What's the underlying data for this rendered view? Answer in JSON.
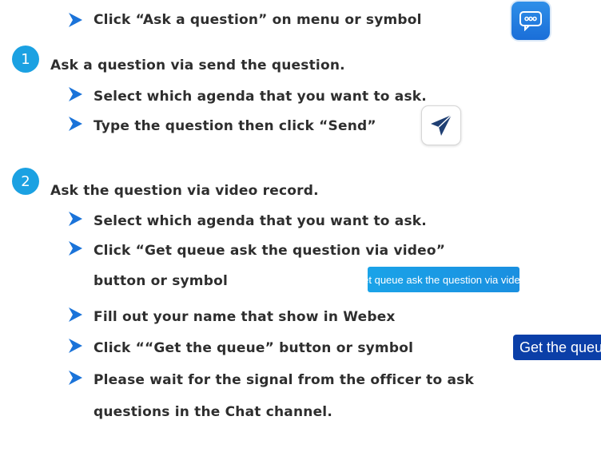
{
  "steps": {
    "intro": "Click “Ask a question” on menu or symbol",
    "s1": {
      "number": "1",
      "title": "Ask a question via send the question.",
      "b1": "Select which agenda that you want to ask.",
      "b2": "Type the question then click “Send”"
    },
    "s2": {
      "number": "2",
      "title": "Ask the question via video record.",
      "b1": "Select which agenda that you want to ask.",
      "b2_line1": "Click “Get queue ask the question via video”",
      "b2_line2": "button or symbol",
      "b3": "Fill out your name that show in Webex",
      "b4": "Click ““Get the queue” button or symbol",
      "b5_line1": "Please wait for the signal from the officer to ask",
      "b5_line2": "questions in the Chat channel."
    }
  },
  "buttons": {
    "video_queue": "Get queue ask the question via video",
    "get_queue": "Get the queue"
  },
  "icons": {
    "chat": "chat-bubble-icon",
    "send": "paper-plane-icon",
    "hand": "raised-hand-icon",
    "bullet": "chevron-right-icon"
  },
  "colors": {
    "chevron": "#1a73d9",
    "number_badge": "#1ba1e2",
    "video_button": "#1a9be4",
    "queue_button": "#0b3fa8",
    "text": "#2e2e2e"
  }
}
